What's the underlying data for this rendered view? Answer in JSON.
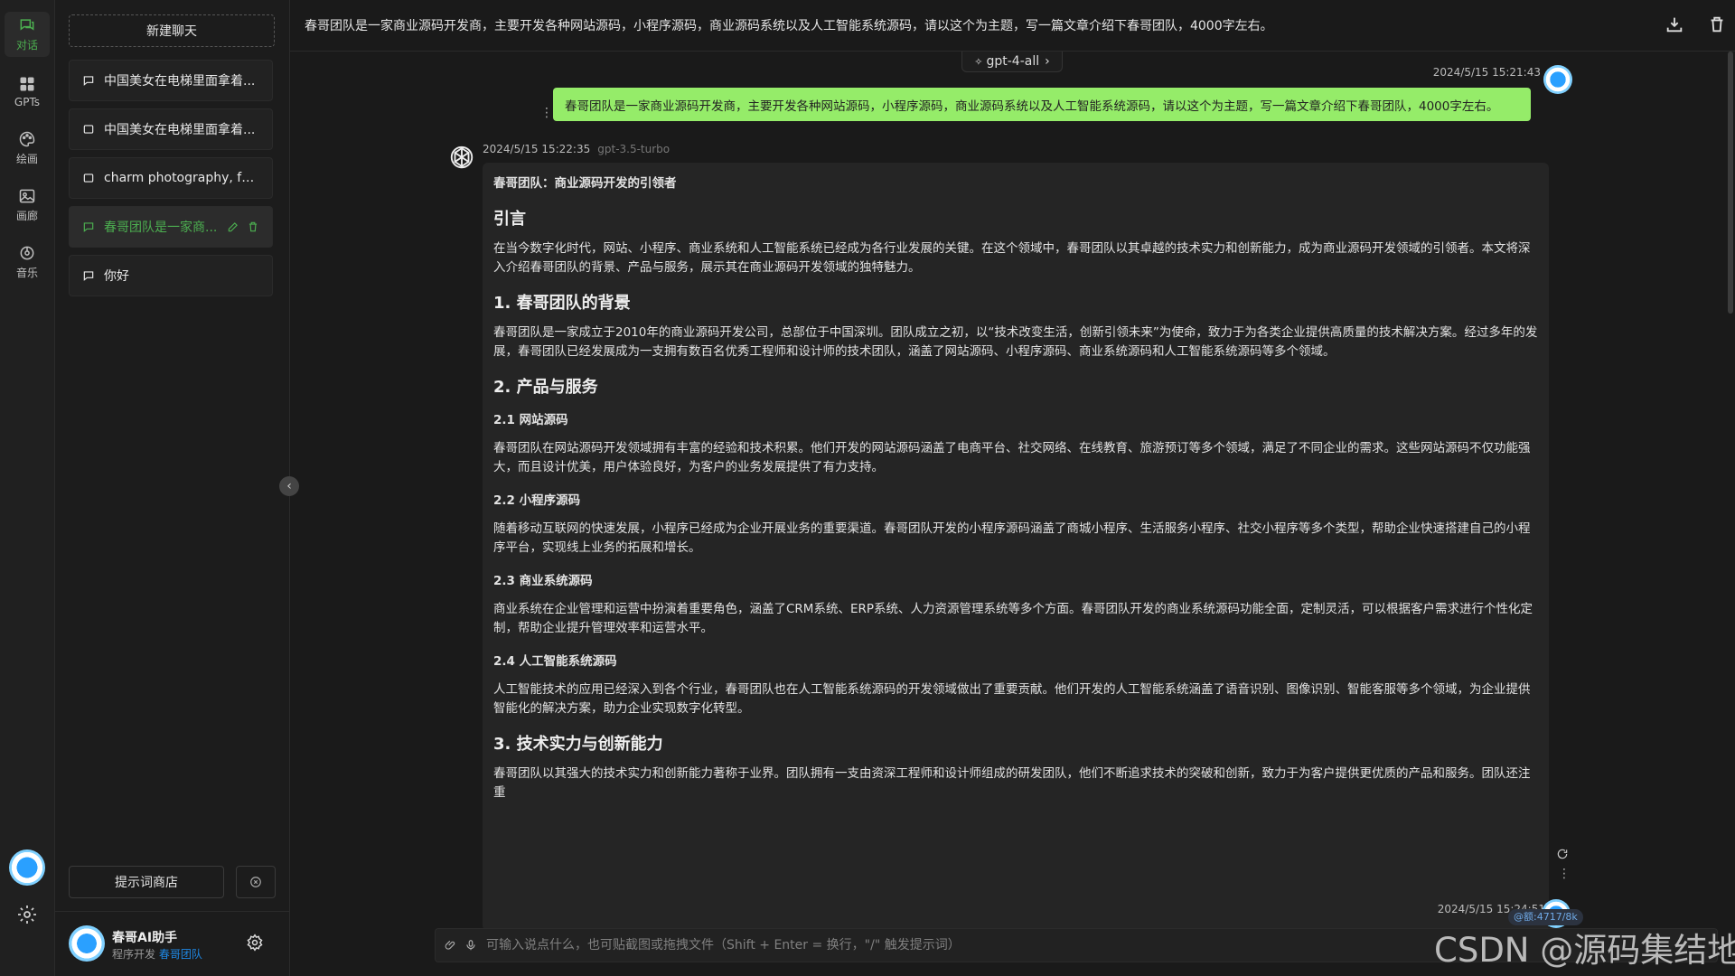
{
  "rail": {
    "items": [
      {
        "label": "对话",
        "icon": "chat-icon",
        "active": true
      },
      {
        "label": "GPTs",
        "icon": "grid-icon"
      },
      {
        "label": "绘画",
        "icon": "palette-icon"
      },
      {
        "label": "画廊",
        "icon": "image-icon"
      },
      {
        "label": "音乐",
        "icon": "music-icon"
      }
    ]
  },
  "sidebar": {
    "new_chat_label": "新建聊天",
    "chats": [
      {
        "title": "中国美女在电梯里面拿着..."
      },
      {
        "title": "中国美女在电梯里面拿着..."
      },
      {
        "title": "charm photography, full..."
      },
      {
        "title": "春哥团队是一家商...",
        "active": true
      },
      {
        "title": "你好"
      }
    ],
    "prompt_store_label": "提示词商店",
    "user": {
      "name": "春哥AI助手",
      "sub_prefix": "程序开发",
      "sub_link": "春哥团队"
    }
  },
  "topbar": {
    "title": "春哥团队是一家商业源码开发商，主要开发各种网站源码，小程序源码，商业源码系统以及人工智能系统源码，请以这个为主题，写一篇文章介绍下春哥团队，4000字左右。",
    "icons": [
      "download-icon",
      "trash-icon"
    ]
  },
  "conversation": {
    "model_selector": "gpt-4-all",
    "user_message": {
      "time": "2024/5/15 15:21:43",
      "text": "春哥团队是一家商业源码开发商，主要开发各种网站源码，小程序源码，商业源码系统以及人工智能系统源码，请以这个为主题，写一篇文章介绍下春哥团队，4000字左右。"
    },
    "ai_message": {
      "time": "2024/5/15 15:22:35",
      "model": "gpt-3.5-turbo",
      "doc_title": "春哥团队：商业源码开发的引领者",
      "h_intro": "引言",
      "p_intro": "在当今数字化时代，网站、小程序、商业系统和人工智能系统已经成为各行业发展的关键。在这个领域中，春哥团队以其卓越的技术实力和创新能力，成为商业源码开发领域的引领者。本文将深入介绍春哥团队的背景、产品与服务，展示其在商业源码开发领域的独特魅力。",
      "h_1": "1. 春哥团队的背景",
      "p_1": "春哥团队是一家成立于2010年的商业源码开发公司，总部位于中国深圳。团队成立之初，以“技术改变生活，创新引领未来”为使命，致力于为各类企业提供高质量的技术解决方案。经过多年的发展，春哥团队已经发展成为一支拥有数百名优秀工程师和设计师的技术团队，涵盖了网站源码、小程序源码、商业系统源码和人工智能系统源码等多个领域。",
      "h_2": "2. 产品与服务",
      "h_21": "2.1 网站源码",
      "p_21": "春哥团队在网站源码开发领域拥有丰富的经验和技术积累。他们开发的网站源码涵盖了电商平台、社交网络、在线教育、旅游预订等多个领域，满足了不同企业的需求。这些网站源码不仅功能强大，而且设计优美，用户体验良好，为客户的业务发展提供了有力支持。",
      "h_22": "2.2 小程序源码",
      "p_22": "随着移动互联网的快速发展，小程序已经成为企业开展业务的重要渠道。春哥团队开发的小程序源码涵盖了商城小程序、生活服务小程序、社交小程序等多个类型，帮助企业快速搭建自己的小程序平台，实现线上业务的拓展和增长。",
      "h_23": "2.3 商业系统源码",
      "p_23": "商业系统在企业管理和运营中扮演着重要角色，涵盖了CRM系统、ERP系统、人力资源管理系统等多个方面。春哥团队开发的商业系统源码功能全面，定制灵活，可以根据客户需求进行个性化定制，帮助企业提升管理效率和运营水平。",
      "h_24": "2.4 人工智能系统源码",
      "p_24": "人工智能技术的应用已经深入到各个行业，春哥团队也在人工智能系统源码的开发领域做出了重要贡献。他们开发的人工智能系统涵盖了语音识别、图像识别、智能客服等多个领域，为企业提供智能化的解决方案，助力企业实现数字化转型。",
      "h_3": "3. 技术实力与创新能力",
      "p_3": "春哥团队以其强大的技术实力和创新能力著称于业界。团队拥有一支由资深工程师和设计师组成的研发团队，他们不断追求技术的突破和创新，致力于为客户提供更优质的产品和服务。团队还注重"
    },
    "next_time": "2024/5/15 15:24:51",
    "token_badge": "@额:4717/8k"
  },
  "composer": {
    "placeholder": "可输入说点什么，也可贴截图或拖拽文件（Shift + Enter = 换行，\"/\" 触发提示词）"
  },
  "watermark": "CSDN @源码集结地",
  "colors": {
    "accent": "#4caf50",
    "user_bubble": "#95ec69",
    "background": "#1a1a1a",
    "link": "#1e88e5"
  }
}
